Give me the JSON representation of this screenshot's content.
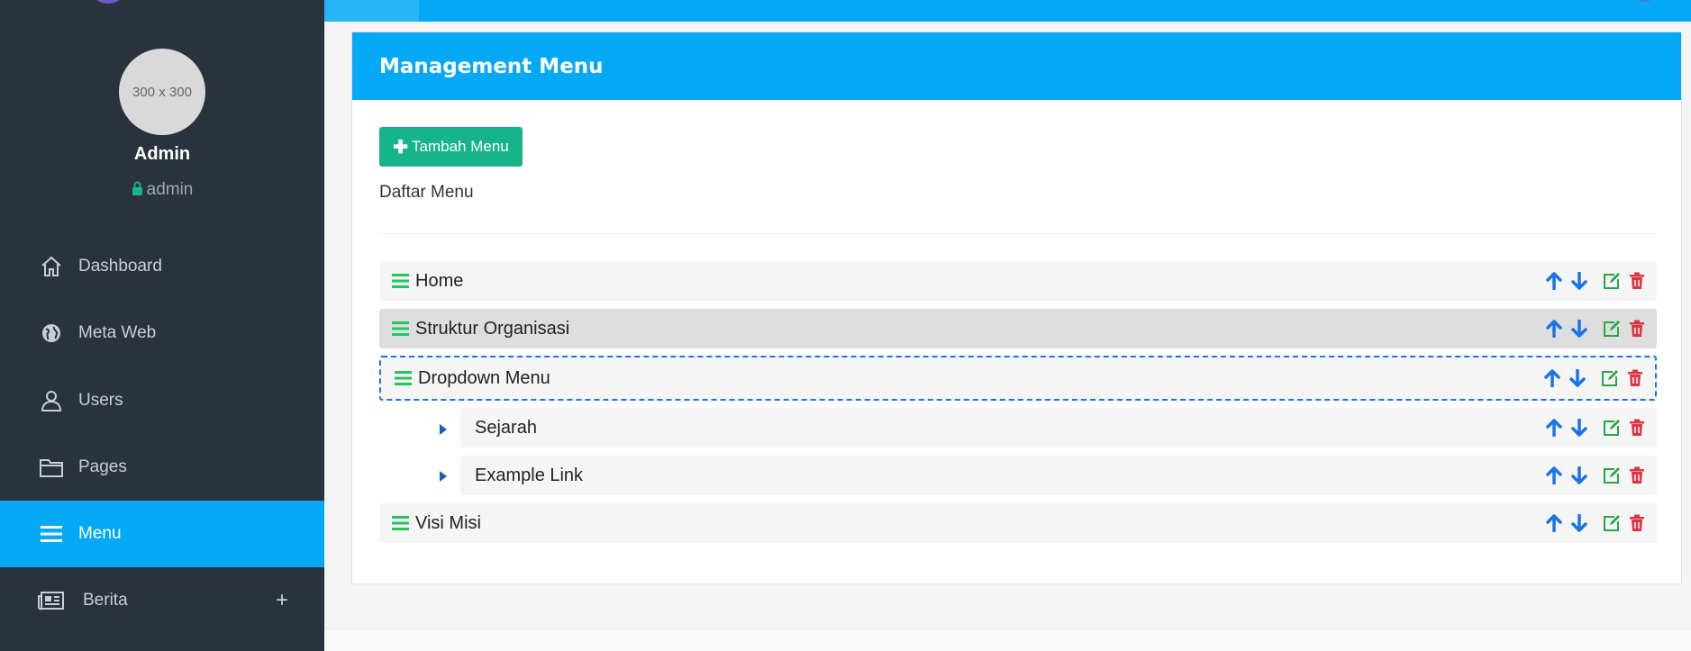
{
  "sidebar": {
    "avatar_text": "300 x 300",
    "user_name": "Admin",
    "user_role": "admin",
    "items": [
      {
        "label": "Dashboard",
        "icon": "home-icon"
      },
      {
        "label": "Meta Web",
        "icon": "globe-icon"
      },
      {
        "label": "Users",
        "icon": "user-icon"
      },
      {
        "label": "Pages",
        "icon": "folder-icon"
      },
      {
        "label": "Menu",
        "icon": "bars-icon",
        "active": true
      },
      {
        "label": "Berita",
        "icon": "newspaper-icon",
        "expand": "+"
      }
    ]
  },
  "card": {
    "title": "Management Menu",
    "add_button": "Tambah Menu",
    "list_title": "Daftar Menu"
  },
  "menu_items": [
    {
      "label": "Home",
      "level": 0
    },
    {
      "label": "Struktur Organisasi",
      "level": 0,
      "state": "hover"
    },
    {
      "label": "Dropdown Menu",
      "level": 0,
      "state": "dragging"
    },
    {
      "label": "Sejarah",
      "level": 1
    },
    {
      "label": "Example Link",
      "level": 1
    },
    {
      "label": "Visi Misi",
      "level": 0
    }
  ],
  "colors": {
    "accent": "#03a9f4",
    "sidebar": "#2a323d",
    "success": "#17b38a",
    "handle": "#22c55e",
    "arrow": "#1a73e8",
    "edit": "#28a745",
    "delete": "#dc3545"
  }
}
